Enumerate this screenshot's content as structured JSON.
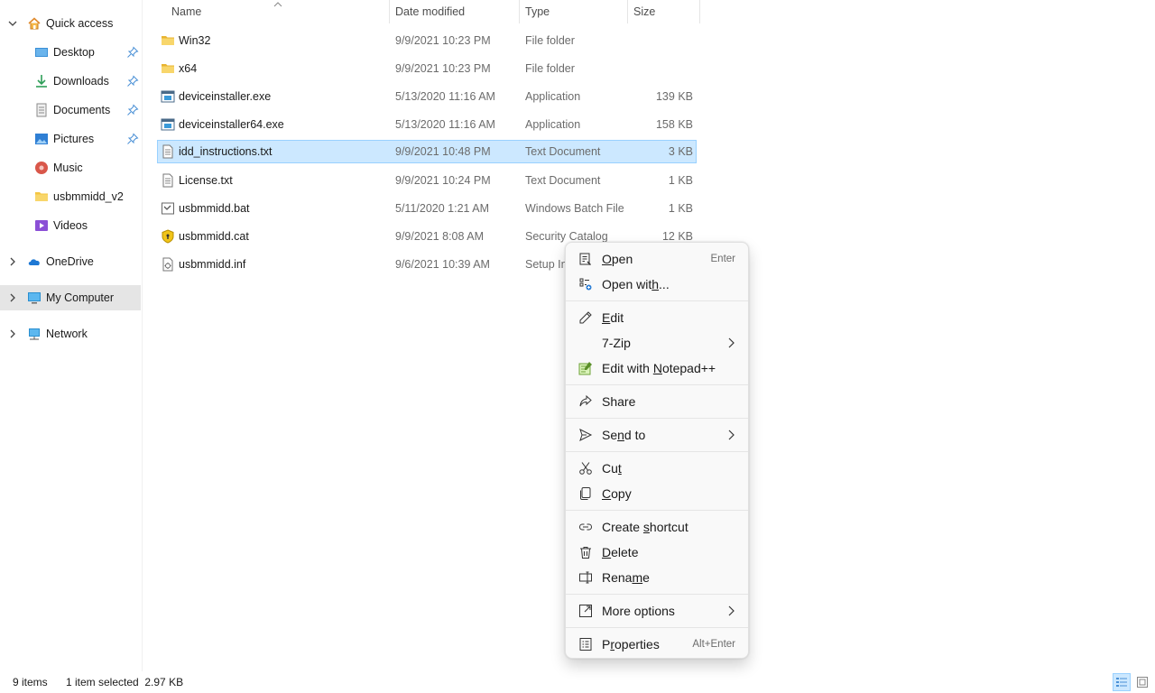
{
  "sidebar": {
    "quick_access": "Quick access",
    "items": [
      {
        "label": "Desktop",
        "icon": "desktop-icon",
        "pinned": true
      },
      {
        "label": "Downloads",
        "icon": "download-icon",
        "pinned": true
      },
      {
        "label": "Documents",
        "icon": "documents-icon",
        "pinned": true
      },
      {
        "label": "Pictures",
        "icon": "pictures-icon",
        "pinned": true
      },
      {
        "label": "Music",
        "icon": "music-icon",
        "pinned": false
      },
      {
        "label": "usbmmidd_v2",
        "icon": "folder-icon",
        "pinned": false
      },
      {
        "label": "Videos",
        "icon": "videos-icon",
        "pinned": false
      }
    ],
    "onedrive": "OneDrive",
    "my_computer": "My Computer",
    "network": "Network"
  },
  "columns": {
    "name": "Name",
    "date": "Date modified",
    "type": "Type",
    "size": "Size"
  },
  "files": [
    {
      "name": "Win32",
      "date": "9/9/2021 10:23 PM",
      "type": "File folder",
      "size": "",
      "icon": "folder-icon"
    },
    {
      "name": "x64",
      "date": "9/9/2021 10:23 PM",
      "type": "File folder",
      "size": "",
      "icon": "folder-icon"
    },
    {
      "name": "deviceinstaller.exe",
      "date": "5/13/2020 11:16 AM",
      "type": "Application",
      "size": "139 KB",
      "icon": "application-icon"
    },
    {
      "name": "deviceinstaller64.exe",
      "date": "5/13/2020 11:16 AM",
      "type": "Application",
      "size": "158 KB",
      "icon": "application-icon"
    },
    {
      "name": "idd_instructions.txt",
      "date": "9/9/2021 10:48 PM",
      "type": "Text Document",
      "size": "3 KB",
      "icon": "text-file-icon"
    },
    {
      "name": "License.txt",
      "date": "9/9/2021 10:24 PM",
      "type": "Text Document",
      "size": "1 KB",
      "icon": "text-file-icon"
    },
    {
      "name": "usbmmidd.bat",
      "date": "5/11/2020 1:21 AM",
      "type": "Windows Batch File",
      "size": "1 KB",
      "icon": "batch-file-icon"
    },
    {
      "name": "usbmmidd.cat",
      "date": "9/9/2021 8:08 AM",
      "type": "Security Catalog",
      "size": "12 KB",
      "icon": "security-catalog-icon"
    },
    {
      "name": "usbmmidd.inf",
      "date": "9/6/2021 10:39 AM",
      "type": "Setup Int",
      "size": "",
      "icon": "setup-info-icon"
    }
  ],
  "status": {
    "items": "9 items",
    "selected": "1 item selected  2.97 KB"
  },
  "context_menu": {
    "open": {
      "pre": "",
      "u": "O",
      "post": "pen",
      "accel": "Enter"
    },
    "open_with": {
      "pre": "Open wit",
      "u": "h",
      "post": "..."
    },
    "edit": {
      "pre": "",
      "u": "E",
      "post": "dit"
    },
    "seven_zip": "7-Zip",
    "edit_notepad": {
      "pre": "Edit with ",
      "u": "N",
      "post": "otepad++"
    },
    "share": "Share",
    "send_to": {
      "pre": "Se",
      "u": "n",
      "post": "d to"
    },
    "cut": {
      "pre": "Cu",
      "u": "t",
      "post": ""
    },
    "copy": {
      "pre": "",
      "u": "C",
      "post": "opy"
    },
    "create_shortcut": {
      "pre": "Create ",
      "u": "s",
      "post": "hortcut"
    },
    "delete": {
      "pre": "",
      "u": "D",
      "post": "elete"
    },
    "rename": {
      "pre": "Rena",
      "u": "m",
      "post": "e"
    },
    "more_options": "More options",
    "properties": {
      "pre": "P",
      "u": "r",
      "post": "operties",
      "accel": "Alt+Enter"
    }
  },
  "colors": {
    "selection_bg": "#cce8ff",
    "selection_border": "#99d1ff",
    "folder": "#f4c542"
  }
}
